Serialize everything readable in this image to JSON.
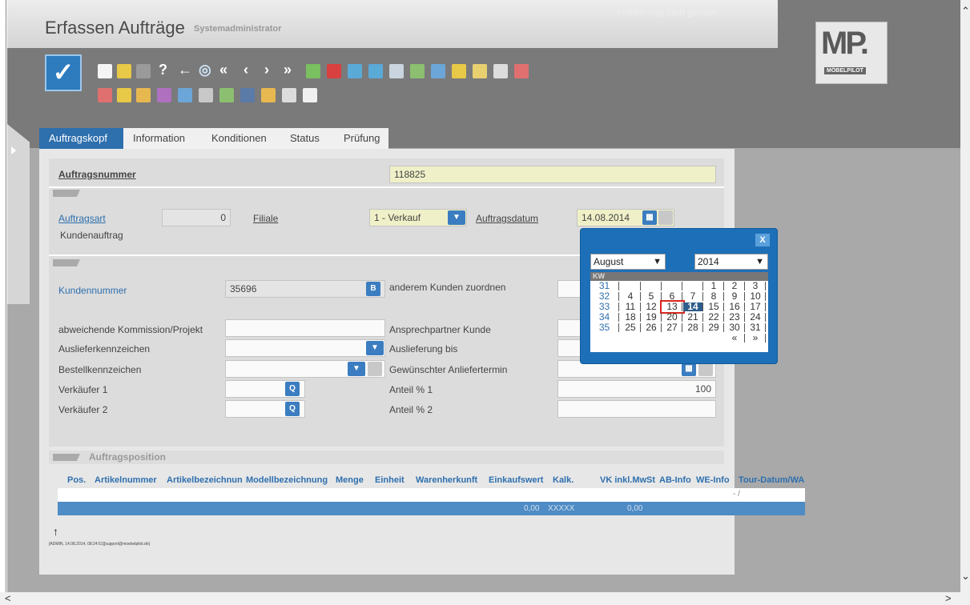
{
  "app": {
    "title": "Erfassen Aufträge",
    "subtitle": "Systemadministrator",
    "status": "Indizierung läuft gerade...",
    "logo_text": "MP.",
    "logo_sub": "MÖBELPILOT"
  },
  "tabs": [
    {
      "label": "Auftragskopf"
    },
    {
      "label": "Information"
    },
    {
      "label": "Konditionen"
    },
    {
      "label": "Status"
    },
    {
      "label": "Prüfung"
    }
  ],
  "form": {
    "auftragsnummer_label": "Auftragsnummer",
    "auftragsnummer_value": "118825",
    "auftragsart_label": "Auftragsart",
    "auftragsart_value": "0",
    "auftragsart_text": "Kundenauftrag",
    "filiale_label": "Filiale",
    "filiale_value": "1 - Verkauf",
    "auftragsdatum_label": "Auftragsdatum",
    "auftragsdatum_value": "14.08.2014",
    "kundennummer_label": "Kundennummer",
    "kundennummer_value": "35696",
    "anderem_kunden_label": "anderem Kunden zuordnen",
    "kommission_label": "abweichende Kommission/Projekt",
    "ansprechpartner_label": "Ansprechpartner Kunde",
    "ausliefer_label": "Auslieferkennzeichen",
    "auslieferung_bis_label": "Auslieferung bis",
    "bestell_label": "Bestellkennzeichen",
    "anliefertermin_label": "Gewünschter Anliefertermin",
    "verkaeufer1_label": "Verkäufer 1",
    "anteil1_label": "Anteil % 1",
    "anteil1_value": "100",
    "verkaeufer2_label": "Verkäufer 2",
    "anteil2_label": "Anteil % 2"
  },
  "calendar": {
    "close_label": "X",
    "month": "August",
    "year": "2014",
    "header": "KW",
    "rows": [
      {
        "kw": "31",
        "days": [
          "",
          "",
          "",
          "",
          "1",
          "2",
          "3"
        ]
      },
      {
        "kw": "32",
        "days": [
          "4",
          "5",
          "6",
          "7",
          "8",
          "9",
          "10"
        ]
      },
      {
        "kw": "33",
        "days": [
          "11",
          "12",
          "13",
          "14",
          "15",
          "16",
          "17"
        ]
      },
      {
        "kw": "34",
        "days": [
          "18",
          "19",
          "20",
          "21",
          "22",
          "23",
          "24"
        ]
      },
      {
        "kw": "35",
        "days": [
          "25",
          "26",
          "27",
          "28",
          "29",
          "30",
          "31"
        ]
      }
    ],
    "nav_prev": "«",
    "nav_next": "»",
    "today": "14",
    "highlighted": "13"
  },
  "positions": {
    "section_title": "Auftragsposition",
    "columns": [
      "Pos.",
      "Artikelnummer",
      "Artikelbezeichnun",
      "Modellbezeichnung",
      "Menge",
      "Einheit",
      "Warenherkunft",
      "Einkaufswert",
      "Kalk.",
      "VK inkl.MwSt",
      "AB-Info",
      "WE-Info",
      "Tour-Datum/WA"
    ],
    "row_tour": "- /",
    "footer_einkauf": "0,00",
    "footer_kalk": "XXXXX",
    "footer_vk": "0,00"
  },
  "footer": {
    "arrow": "↑",
    "info": "[ADMIN, 14.08.2014, 08:24:51][support@moebelpilot.de]"
  },
  "scroll": {
    "up": "⌃",
    "down": "⌄",
    "left": "<",
    "right": ">"
  }
}
